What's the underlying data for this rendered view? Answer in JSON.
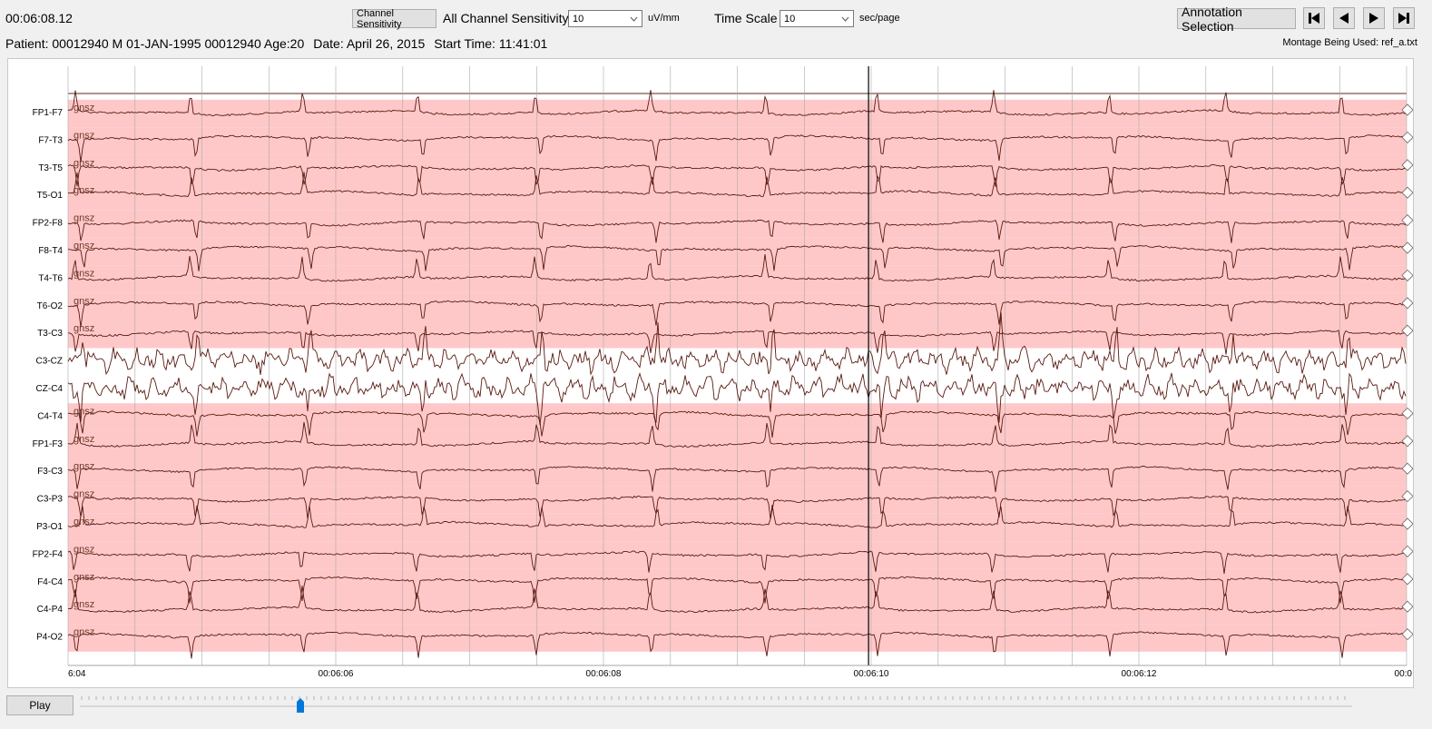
{
  "toolbar": {
    "clock": "00:06:08.12",
    "channel_sensitivity_button": "Channel Sensitivity",
    "all_channel_sensitivity_label": "All Channel Sensitivity",
    "sensitivity_value": "10",
    "sensitivity_unit": "uV/mm",
    "time_scale_label": "Time Scale",
    "time_scale_value": "10",
    "time_scale_unit": "sec/page",
    "annotation_selection_button": "Annotation Selection",
    "nav_icons": [
      "skip-to-start-icon",
      "step-back-icon",
      "play-forward-icon",
      "skip-to-end-icon"
    ]
  },
  "info": {
    "patient": "Patient: 00012940 M 01-JAN-1995 00012940 Age:20",
    "date": "Date: April 26, 2015",
    "start_time": "Start Time: 11:41:01",
    "montage": "Montage Being Used: ref_a.txt"
  },
  "eeg": {
    "channels": [
      "FP1-F7",
      "F7-T3",
      "T3-T5",
      "T5-O1",
      "FP2-F8",
      "F8-T4",
      "T4-T6",
      "T6-O2",
      "T3-C3",
      "C3-CZ",
      "CZ-C4",
      "C4-T4",
      "FP1-F3",
      "F3-C3",
      "C3-P3",
      "P3-O1",
      "FP2-F4",
      "F4-C4",
      "C4-P4",
      "P4-O2"
    ],
    "annotated_channels": [
      "FP1-F7",
      "F7-T3",
      "T3-T5",
      "T5-O1",
      "FP2-F8",
      "F8-T4",
      "T4-T6",
      "T6-O2",
      "T3-C3",
      "C4-T4",
      "FP1-F3",
      "F3-C3",
      "C3-P3",
      "P3-O1",
      "FP2-F4",
      "F4-C4",
      "C4-P4",
      "P4-O2"
    ],
    "annotation_label": "gnsz",
    "annotation_color": "#ffc8c8",
    "trace_color": "#5a1a12",
    "time_ticks": [
      {
        "t": 4,
        "label": "6:04"
      },
      {
        "t": 6,
        "label": "00:06:06"
      },
      {
        "t": 8,
        "label": "00:06:08"
      },
      {
        "t": 10,
        "label": "00:06:10"
      },
      {
        "t": 12,
        "label": "00:06:12"
      },
      {
        "t": 14,
        "label": "00:0"
      }
    ],
    "time_range": [
      4,
      14
    ],
    "cursor_time": 9.98
  },
  "playback": {
    "play_label": "Play",
    "slider_position": 0.173
  }
}
